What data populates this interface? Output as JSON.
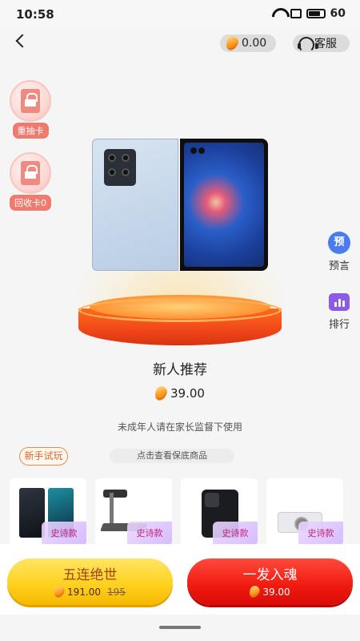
{
  "status_bar": {
    "time": "10:58",
    "battery": "60"
  },
  "header": {
    "balance": "0.00",
    "service_label": "客服"
  },
  "side_cards": [
    {
      "label": "重抽卡"
    },
    {
      "label": "回收卡0"
    }
  ],
  "right_menu": {
    "predict_icon_text": "预",
    "predict_label": "预言",
    "rank_label": "排行"
  },
  "product": {
    "name": "新人推荐",
    "price": "39.00"
  },
  "notice": "未成年人请在家长监督下使用",
  "trial_label": "新手试玩",
  "guarantee_label": "点击查看保底商品",
  "thumbs": [
    {
      "badge": "史诗款"
    },
    {
      "badge": "史诗款"
    },
    {
      "badge": "史诗款"
    },
    {
      "badge": "史诗款"
    }
  ],
  "actions": {
    "five": {
      "title": "五连绝世",
      "price": "191.00",
      "old_price": "195"
    },
    "one": {
      "title": "一发入魂",
      "price": "39.00"
    }
  }
}
